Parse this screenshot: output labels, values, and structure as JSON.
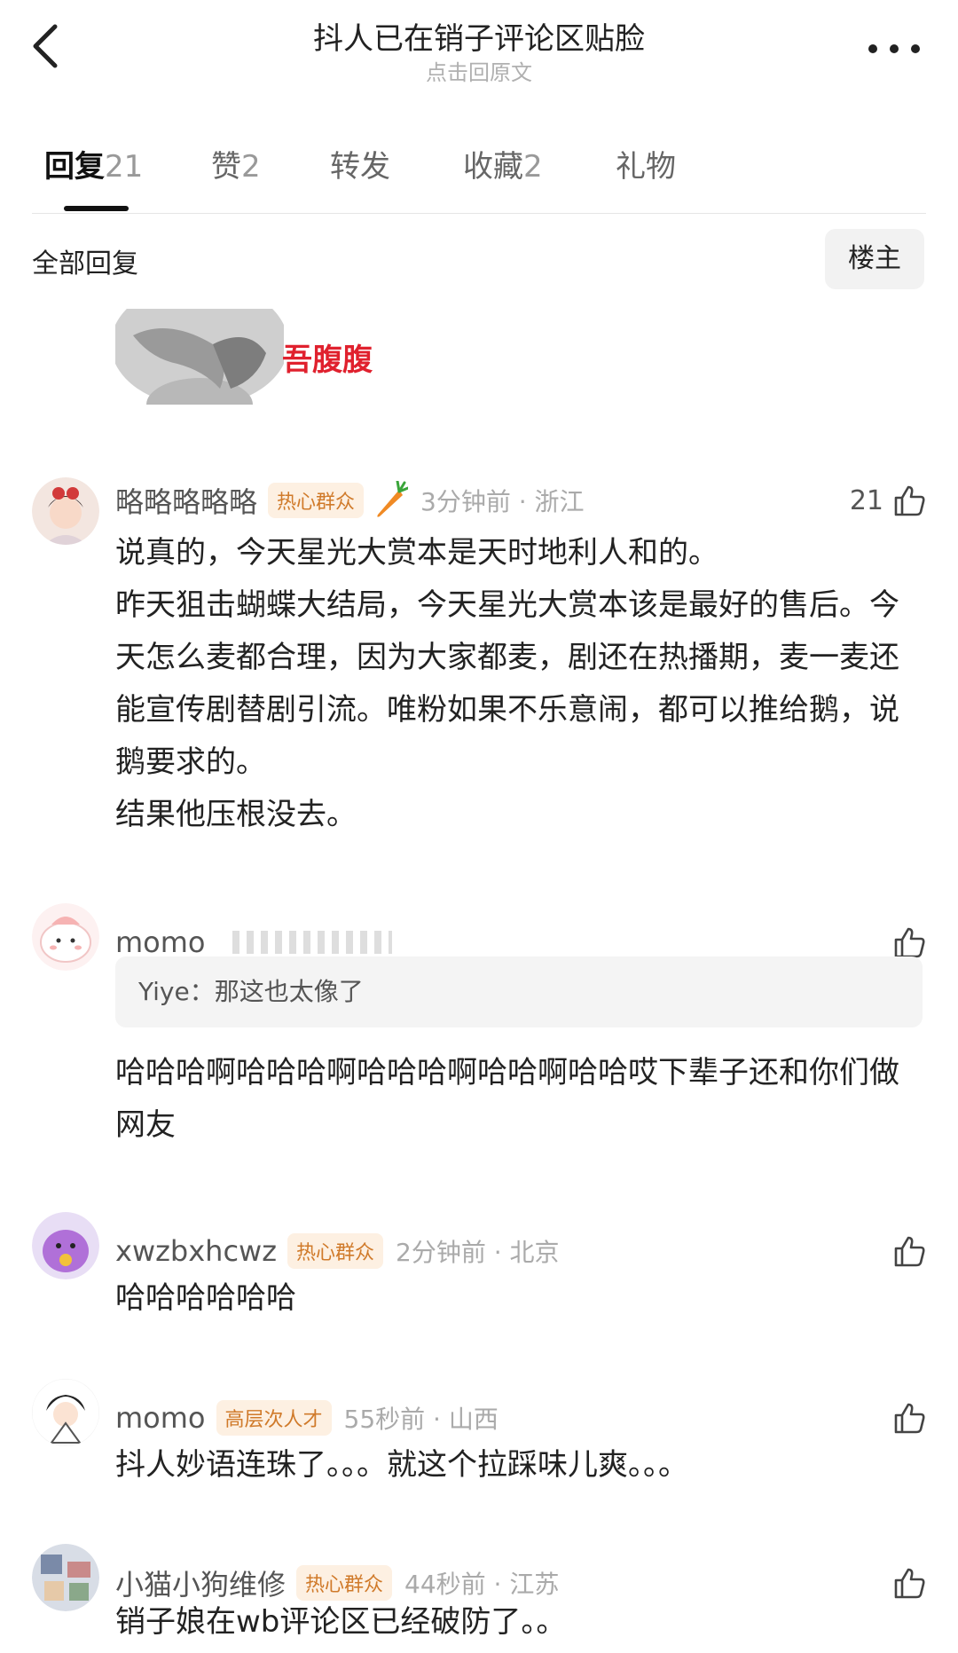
{
  "header": {
    "title": "抖人已在销子评论区贴脸",
    "subtitle": "点击回原文"
  },
  "tabs": [
    {
      "label": "回复",
      "count": "21"
    },
    {
      "label": "赞",
      "count": "2"
    },
    {
      "label": "转发",
      "count": ""
    },
    {
      "label": "收藏",
      "count": "2"
    },
    {
      "label": "礼物",
      "count": ""
    }
  ],
  "filter": {
    "all_label": "全部回复",
    "op_label": "楼主"
  },
  "sticker": {
    "text": "吾腹腹"
  },
  "comments": [
    {
      "username": "略略略略略",
      "badge": "热心群众",
      "time": "3分钟前 · 浙江",
      "likes": "21",
      "text": "说真的，今天星光大赏本是天时地利人和的。\n昨天狙击蝴蝶大结局，今天星光大赏本该是最好的售后。今天怎么麦都合理，因为大家都麦，剧还在热播期，麦一麦还能宣传剧替剧引流。唯粉如果不乐意闹，都可以推给鹅，说鹅要求的。\n结果他压根没去。"
    },
    {
      "username": "momo",
      "quote_name": "Yiye：",
      "quote_text": "那这也太像了",
      "text": "哈哈哈啊哈哈哈啊哈哈哈啊哈哈啊哈哈哎下辈子还和你们做网友"
    },
    {
      "username": "xwzbxhcwz",
      "badge": "热心群众",
      "time": "2分钟前 · 北京",
      "text": "哈哈哈哈哈哈"
    },
    {
      "username": "momo",
      "badge": "高层次人才",
      "time": "55秒前 · 山西",
      "text": "抖人妙语连珠了。。。就这个拉踩味儿爽。。。"
    },
    {
      "username": "小猫小狗维修",
      "badge": "热心群众",
      "time": "44秒前 · 江苏",
      "text": "销子娘在wb评论区已经破防了。。"
    }
  ],
  "colors": {
    "badge_text": "#d07a2a",
    "badge_bg": "#fdf0e2",
    "sticker_text": "#e0212e"
  }
}
